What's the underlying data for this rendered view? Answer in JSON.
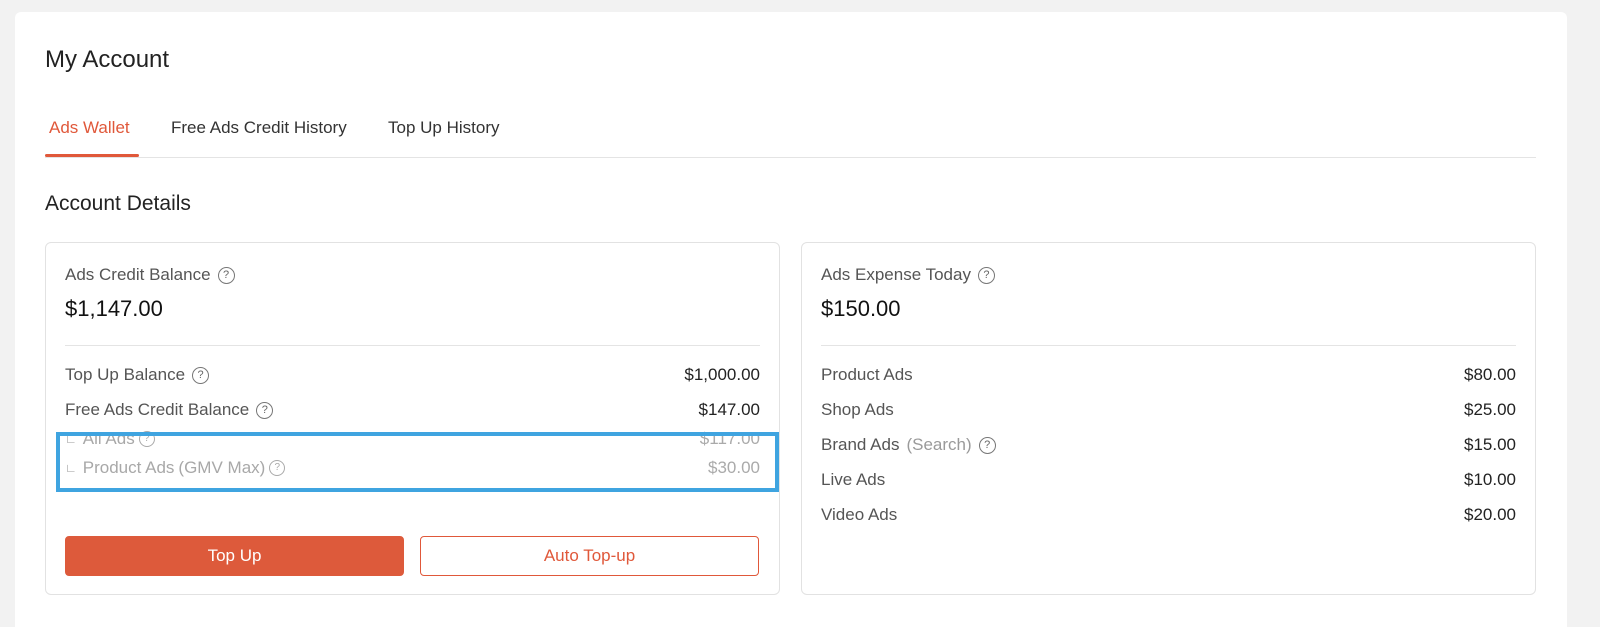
{
  "page": {
    "title": "My Account"
  },
  "tabs": [
    {
      "label": "Ads Wallet",
      "active": true
    },
    {
      "label": "Free Ads Credit History",
      "active": false
    },
    {
      "label": "Top Up History",
      "active": false
    }
  ],
  "section": {
    "title": "Account Details"
  },
  "left_panel": {
    "label": "Ads Credit Balance",
    "amount": "$1,147.00",
    "rows": [
      {
        "label": "Top Up Balance",
        "value": "$1,000.00"
      },
      {
        "label": "Free Ads Credit Balance",
        "value": "$147.00"
      }
    ],
    "sub_rows": [
      {
        "label": "All Ads",
        "value": "$117.00"
      },
      {
        "label": "Product Ads",
        "suffix": "(GMV Max)",
        "value": "$30.00"
      }
    ],
    "buttons": {
      "top_up": "Top Up",
      "auto_top_up": "Auto Top-up"
    }
  },
  "right_panel": {
    "label": "Ads Expense Today",
    "amount": "$150.00",
    "rows": [
      {
        "label": "Product Ads",
        "value": "$80.00"
      },
      {
        "label": "Shop Ads",
        "value": "$25.00"
      },
      {
        "label": "Brand Ads",
        "suffix": "(Search)",
        "value": "$15.00"
      },
      {
        "label": "Live Ads",
        "value": "$10.00"
      },
      {
        "label": "Video Ads",
        "value": "$20.00"
      }
    ]
  },
  "icons": {
    "help": "?"
  },
  "colors": {
    "accent": "#e0583a",
    "highlight": "#3fa4e0"
  }
}
